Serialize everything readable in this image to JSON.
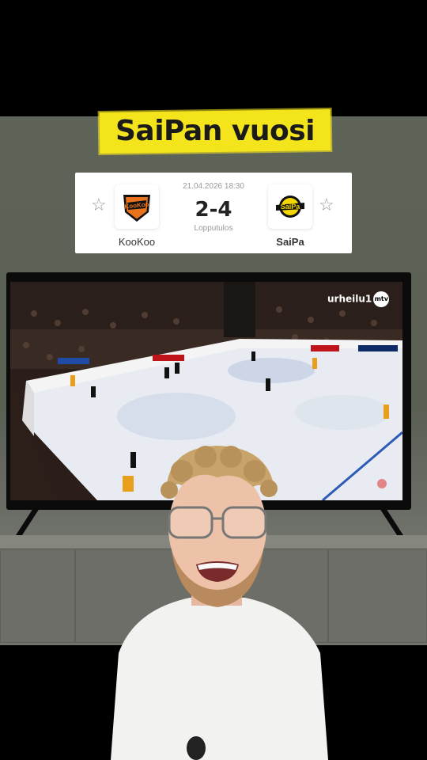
{
  "title": "SaiPan vuosi",
  "match": {
    "date": "21.04.2026 18:30",
    "score": "2-4",
    "status": "Lopputulos",
    "home_team": "KooKoo",
    "away_team": "SaiPa"
  },
  "broadcaster": {
    "name": "urheilu1",
    "badge": "mtv"
  },
  "colors": {
    "title_highlight": "#f3e41c",
    "kookoo_orange": "#e8731c",
    "saipa_yellow": "#f4d600",
    "wall": "#5f6458",
    "ice": "#e8ecf2"
  },
  "icons": [
    "star-icon",
    "kookoo-logo",
    "saipa-logo",
    "mtv-badge"
  ]
}
